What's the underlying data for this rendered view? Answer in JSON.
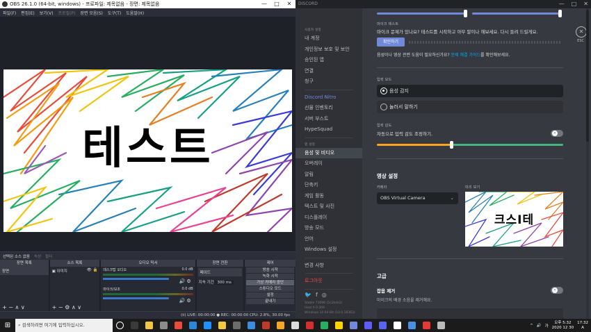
{
  "obs": {
    "title": "OBS 26.1.0 (64-bit, windows) - 프로파일: 제목없음 - 장면: 제목없음",
    "controls": [
      "—",
      "□",
      "✕"
    ],
    "menu": [
      {
        "label": "파일(F)",
        "dim": false
      },
      {
        "label": "편집(E)",
        "dim": false
      },
      {
        "label": "보기(V)",
        "dim": false
      },
      {
        "label": "프로필(P)",
        "dim": true
      },
      {
        "label": "장면 모음(S)",
        "dim": false
      },
      {
        "label": "도구(T)",
        "dim": false
      },
      {
        "label": "도움말(H)",
        "dim": false
      }
    ],
    "preview_text": "테스트",
    "source_bar": {
      "label": "선택된 소스 없음",
      "props": "속성",
      "filters": "필터"
    },
    "docks": {
      "scenes": {
        "header": "장면 목록",
        "item": "장면"
      },
      "sources": {
        "header": "소스 목록",
        "item": "이미지"
      },
      "mixer": {
        "header": "오디오 믹서",
        "tracks": [
          {
            "name": "데스크탑 오디오",
            "db": "0.0 dB"
          },
          {
            "name": "마이크/보조",
            "db": "0.0 dB"
          }
        ]
      },
      "transitions": {
        "header": "장면 전환",
        "type": "페이드",
        "duration_label": "지속 기간",
        "duration": "300 ms"
      },
      "controls": {
        "header": "제어",
        "buttons": [
          "방송 시작",
          "녹화 시작",
          "가상 카메라 중단",
          "스튜디오 모드",
          "설정",
          "끝내기"
        ]
      }
    },
    "status": "(ii) LIVE: 00:00:00  ●  REC: 00:00:00  CPU: 2.8%, 30.00 fps"
  },
  "discord": {
    "title": "DISCORD",
    "window_controls": [
      "—",
      "□",
      "✕"
    ],
    "sidebar": {
      "user_header": "사용자 설정",
      "user_items": [
        "내 계정",
        "개인정보 보호 및 보안",
        "승인된 앱",
        "연결",
        "청구"
      ],
      "nitro_items": [
        "Discord Nitro",
        "선물 인벤토리",
        "서버 부스트",
        "HypeSquad"
      ],
      "app_header": "앱 설정",
      "app_items": [
        "음성 및 비디오",
        "오버레이",
        "알림",
        "단축키",
        "게임 활동",
        "텍스트 및 사진",
        "디스플레이",
        "방송 모드",
        "언어",
        "Windows 설정"
      ],
      "changelog": "변경 사항",
      "logout": "로그아웃",
      "social": [
        "🐦",
        "f",
        "◎"
      ],
      "build": [
        "Stable 73096 (5c2bde2)",
        "Host 0.0.309",
        "Windows 10 64-Bit (10.0.18363)"
      ]
    },
    "mic_test": {
      "label": "마이크 테스트",
      "desc": "마이크 문제가 있나요? 테스트를 시작하고 아무 말이나 해보세요. 다시 들려 드릴게요.",
      "button": "확인하기",
      "help_pre": "음성이나 영상 관련 도움이 필요하신가요?",
      "help_link": "문제 해결 가이드",
      "help_post": "를 확인해보세요."
    },
    "input_mode": {
      "label": "입력 모드",
      "options": [
        "음성 감지",
        "눌러서 말하기"
      ],
      "selected": 0
    },
    "sensitivity": {
      "label": "입력 감도",
      "auto_text": "자동으로 입력 감도 조정하기.",
      "level": 0.4
    },
    "video": {
      "header": "영상 설정",
      "camera_label": "카메라",
      "camera_value": "OBS Virtual Camera",
      "preview_label": "미리 보기",
      "preview_text": "크스I테"
    },
    "advanced": {
      "header": "고급",
      "noise_label": "잡음 제거",
      "noise_desc": "마이크의 배경 소음을 제거해요."
    },
    "esc": "ESC"
  },
  "taskbar": {
    "search_placeholder": "검색하려면 여기에 입력하십시오.",
    "apps": [
      "#fff",
      "#3a3a3a",
      "#f2c744",
      "#8c8c8c",
      "#e74c3c",
      "#2b88d8",
      "#1e90ff",
      "#f2c744",
      "#6c6c6c",
      "#3c8dde",
      "#c0392b",
      "#f5a623",
      "#dcdcdc",
      "#d32f2f",
      "#27ae60",
      "#ffd400",
      "#7289da",
      "#5c5cff",
      "#5865f2",
      "#ffffff",
      "#4a90e2",
      "#e53935",
      "#bbbbbb"
    ],
    "tray": [
      "^",
      "🔊",
      "가",
      "A"
    ],
    "time": "오후 5:32",
    "date": "2020  12  30",
    "clock_extra": "17:32"
  }
}
